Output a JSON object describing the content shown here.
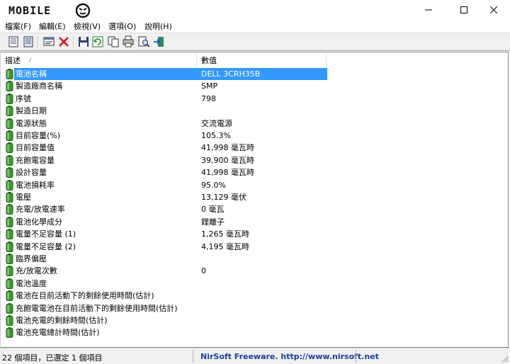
{
  "window": {
    "logo_text": "MOBILE",
    "controls": {
      "minimize": "minimize",
      "maximize": "maximize",
      "close": "close"
    }
  },
  "menu": [
    {
      "label": "檔案(F)"
    },
    {
      "label": "編輯(E)"
    },
    {
      "label": "檢視(V)"
    },
    {
      "label": "選項(O)"
    },
    {
      "label": "說明(H)"
    }
  ],
  "columns": {
    "name": "描述",
    "value": "數值"
  },
  "rows": [
    {
      "name": "電池名稱",
      "value": "DELL 3CRH35B"
    },
    {
      "name": "製造廠商名稱",
      "value": "SMP"
    },
    {
      "name": "序號",
      "value": "798"
    },
    {
      "name": "製造日期",
      "value": ""
    },
    {
      "name": "電源狀態",
      "value": "交流電源"
    },
    {
      "name": "目前容量(%)",
      "value": "105.3%"
    },
    {
      "name": "目前容量值",
      "value": "41,998 毫瓦時"
    },
    {
      "name": "充飽電容量",
      "value": "39,900 毫瓦時"
    },
    {
      "name": "設計容量",
      "value": "41,998 毫瓦時"
    },
    {
      "name": "電池損耗率",
      "value": "95.0%"
    },
    {
      "name": "電壓",
      "value": "13,129 毫伏"
    },
    {
      "name": "充電/放電速率",
      "value": "0 毫瓦"
    },
    {
      "name": "電池化學成分",
      "value": "鋰離子"
    },
    {
      "name": "電量不足容量 (1)",
      "value": "1,265 毫瓦時"
    },
    {
      "name": "電量不足容量 (2)",
      "value": "4,195 毫瓦時"
    },
    {
      "name": "臨界偏壓",
      "value": ""
    },
    {
      "name": "充/放電次數",
      "value": "0"
    },
    {
      "name": "電池溫度",
      "value": ""
    },
    {
      "name": "電池在目前活動下的剩餘使用時間(估計)",
      "value": ""
    },
    {
      "name": "充飽電電池在目前活動下的剩餘使用時間(估計)",
      "value": ""
    },
    {
      "name": "電池充電的剩餘時間(估計)",
      "value": ""
    },
    {
      "name": "電池充電總計時間(估計)",
      "value": ""
    }
  ],
  "selected_row": 0,
  "status": {
    "items_text": "22 個項目，已選定 1 個項目",
    "credit": "NirSoft Freeware.  http://www.nirsoft.net"
  },
  "colors": {
    "selection": "#3399ff",
    "credit": "#1c3f9c",
    "battery": "#3c9a2e"
  }
}
